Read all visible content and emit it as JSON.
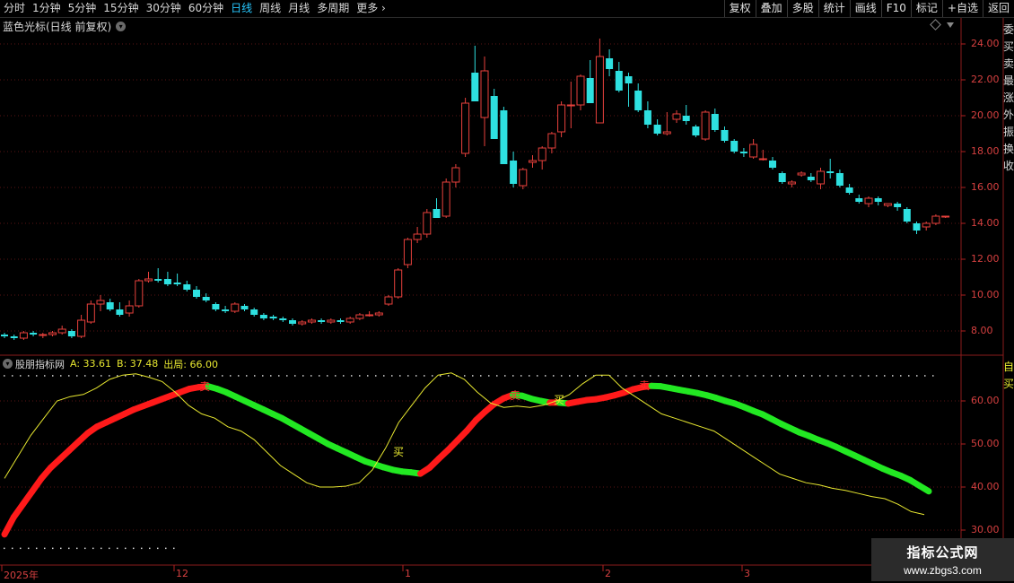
{
  "toolbar": {
    "periods": [
      "分时",
      "1分钟",
      "5分钟",
      "15分钟",
      "30分钟",
      "60分钟",
      "日线",
      "周线",
      "月线",
      "多周期",
      "更多"
    ],
    "active_period": "日线",
    "buttons": [
      "复权",
      "叠加",
      "多股",
      "统计",
      "画线",
      "F10",
      "标记",
      "+自选",
      "返回"
    ]
  },
  "price_chart": {
    "title": "蓝色光标(日线 前复权)",
    "axis_labels": [
      "24.00",
      "22.00",
      "20.00",
      "18.00",
      "16.00",
      "14.00",
      "12.00",
      "10.00",
      "8.00"
    ],
    "up_color": "#e8413c",
    "down_color": "#2ee0e0"
  },
  "indicator": {
    "name": "股朋指标网",
    "a_label": "A: 33.61",
    "b_label": "B: 37.48",
    "out_label": "出局: 66.00",
    "axis_labels": [
      "60.00",
      "50.00",
      "40.00",
      "30.00"
    ],
    "signals": {
      "sell": "卖",
      "buy": "买"
    },
    "colors": {
      "rising": "#ff1a1a",
      "falling": "#22e822",
      "line_a": "#e8e830",
      "dots": "#d8d8d8"
    }
  },
  "date_axis": [
    "2025年",
    "12",
    "1",
    "2",
    "3"
  ],
  "sidebar_text": "委买卖最涨外振换收",
  "sidebar_text_lower": "自买",
  "watermark": {
    "title": "指标公式网",
    "url": "www.zbgs3.com"
  },
  "chart_data": {
    "type": "candlestick",
    "title": "蓝色光标(日线 前复权)",
    "ylim": [
      7,
      25
    ],
    "candles": [
      [
        7.8,
        7.9,
        7.6,
        7.7
      ],
      [
        7.7,
        7.8,
        7.5,
        7.6
      ],
      [
        7.6,
        8.0,
        7.5,
        7.9
      ],
      [
        7.9,
        8.0,
        7.7,
        7.8
      ],
      [
        7.8,
        7.9,
        7.6,
        7.8
      ],
      [
        7.8,
        8.0,
        7.7,
        7.9
      ],
      [
        7.9,
        8.3,
        7.8,
        8.1
      ],
      [
        8.0,
        8.1,
        7.6,
        7.7
      ],
      [
        7.7,
        8.9,
        7.6,
        8.6
      ],
      [
        8.5,
        9.7,
        8.4,
        9.5
      ],
      [
        9.5,
        10.0,
        9.1,
        9.7
      ],
      [
        9.6,
        9.8,
        9.1,
        9.2
      ],
      [
        9.2,
        9.6,
        8.8,
        8.9
      ],
      [
        9.0,
        9.7,
        8.8,
        9.4
      ],
      [
        9.4,
        10.9,
        9.3,
        10.8
      ],
      [
        10.8,
        11.3,
        10.7,
        10.9
      ],
      [
        10.9,
        11.5,
        10.7,
        10.8
      ],
      [
        10.9,
        11.3,
        10.5,
        10.6
      ],
      [
        10.7,
        11.2,
        10.5,
        10.6
      ],
      [
        10.6,
        10.8,
        10.2,
        10.3
      ],
      [
        10.3,
        10.5,
        9.8,
        9.9
      ],
      [
        9.9,
        10.1,
        9.6,
        9.7
      ],
      [
        9.5,
        9.6,
        9.1,
        9.2
      ],
      [
        9.2,
        9.4,
        9.0,
        9.1
      ],
      [
        9.1,
        9.6,
        9.0,
        9.5
      ],
      [
        9.4,
        9.5,
        9.1,
        9.2
      ],
      [
        9.2,
        9.3,
        8.8,
        8.9
      ],
      [
        8.9,
        9.0,
        8.6,
        8.7
      ],
      [
        8.8,
        8.9,
        8.6,
        8.7
      ],
      [
        8.7,
        8.8,
        8.5,
        8.6
      ],
      [
        8.6,
        8.7,
        8.3,
        8.4
      ],
      [
        8.4,
        8.6,
        8.3,
        8.5
      ],
      [
        8.5,
        8.7,
        8.4,
        8.6
      ],
      [
        8.6,
        8.7,
        8.4,
        8.5
      ],
      [
        8.5,
        8.7,
        8.4,
        8.6
      ],
      [
        8.6,
        8.7,
        8.4,
        8.5
      ],
      [
        8.5,
        8.8,
        8.4,
        8.7
      ],
      [
        8.7,
        9.0,
        8.6,
        8.9
      ],
      [
        8.9,
        9.1,
        8.8,
        8.9
      ],
      [
        8.9,
        9.1,
        8.8,
        9.0
      ],
      [
        9.5,
        10.0,
        9.4,
        9.9
      ],
      [
        9.9,
        11.5,
        9.8,
        11.4
      ],
      [
        11.7,
        13.2,
        11.5,
        13.1
      ],
      [
        13.1,
        13.8,
        12.9,
        13.4
      ],
      [
        13.4,
        14.8,
        13.2,
        14.6
      ],
      [
        14.8,
        15.4,
        14.3,
        14.3
      ],
      [
        14.4,
        16.5,
        14.3,
        16.3
      ],
      [
        16.3,
        17.3,
        16.0,
        17.1
      ],
      [
        17.9,
        21.0,
        17.7,
        20.7
      ],
      [
        22.4,
        23.9,
        20.8,
        20.8
      ],
      [
        19.9,
        23.3,
        18.3,
        22.5
      ],
      [
        21.1,
        21.5,
        19.0,
        18.7
      ],
      [
        20.3,
        20.5,
        18.2,
        17.3
      ],
      [
        17.5,
        18.0,
        16.0,
        16.2
      ],
      [
        16.1,
        17.1,
        15.9,
        17.0
      ],
      [
        17.4,
        17.8,
        17.1,
        17.5
      ],
      [
        17.5,
        18.3,
        17.0,
        18.2
      ],
      [
        18.2,
        19.1,
        17.9,
        19.0
      ],
      [
        19.1,
        20.8,
        18.8,
        20.6
      ],
      [
        20.6,
        21.9,
        19.3,
        20.6
      ],
      [
        20.6,
        22.3,
        20.3,
        22.2
      ],
      [
        22.1,
        23.1,
        20.8,
        20.7
      ],
      [
        19.6,
        24.3,
        19.6,
        23.3
      ],
      [
        23.2,
        23.7,
        22.2,
        22.6
      ],
      [
        22.5,
        23.0,
        21.3,
        21.4
      ],
      [
        22.2,
        22.4,
        20.5,
        21.8
      ],
      [
        21.4,
        21.8,
        20.2,
        20.3
      ],
      [
        20.3,
        20.8,
        19.3,
        19.5
      ],
      [
        19.5,
        19.8,
        18.9,
        19.0
      ],
      [
        19.0,
        20.2,
        18.9,
        19.1
      ],
      [
        19.8,
        20.3,
        19.6,
        20.1
      ],
      [
        20.0,
        20.6,
        19.5,
        19.7
      ],
      [
        19.4,
        19.5,
        18.8,
        18.9
      ],
      [
        18.7,
        20.3,
        18.6,
        20.2
      ],
      [
        20.1,
        20.4,
        19.1,
        19.2
      ],
      [
        19.2,
        19.4,
        18.5,
        18.6
      ],
      [
        18.6,
        18.7,
        17.9,
        18.0
      ],
      [
        18.0,
        18.2,
        17.7,
        17.9
      ],
      [
        17.7,
        18.7,
        17.6,
        18.4
      ],
      [
        17.6,
        18.1,
        17.5,
        17.6
      ],
      [
        17.5,
        17.7,
        17.0,
        17.1
      ],
      [
        16.8,
        16.9,
        16.2,
        16.3
      ],
      [
        16.2,
        16.4,
        16.0,
        16.3
      ],
      [
        16.7,
        16.9,
        16.6,
        16.8
      ],
      [
        16.6,
        16.8,
        16.3,
        16.4
      ],
      [
        16.2,
        17.1,
        15.9,
        16.9
      ],
      [
        16.9,
        17.6,
        16.5,
        16.8
      ],
      [
        16.8,
        17.0,
        16.0,
        16.1
      ],
      [
        16.0,
        16.2,
        15.6,
        15.7
      ],
      [
        15.4,
        15.6,
        15.1,
        15.2
      ],
      [
        15.1,
        15.5,
        14.9,
        15.4
      ],
      [
        15.4,
        15.5,
        15.0,
        15.2
      ],
      [
        15.0,
        15.1,
        14.9,
        15.1
      ],
      [
        15.1,
        15.2,
        14.7,
        14.9
      ],
      [
        14.8,
        14.9,
        14.0,
        14.1
      ],
      [
        14.0,
        14.1,
        13.4,
        13.6
      ],
      [
        13.8,
        14.1,
        13.6,
        14.0
      ],
      [
        14.0,
        14.5,
        13.9,
        14.4
      ],
      [
        14.4,
        14.4,
        14.3,
        14.4
      ]
    ],
    "indicator": {
      "ylim": [
        28,
        68
      ],
      "out_level": 66,
      "main": [
        29,
        33,
        36,
        39,
        42,
        44.5,
        46.5,
        48.5,
        50.5,
        52.5,
        54,
        55,
        56,
        57,
        58,
        58.8,
        59.6,
        60.4,
        61.2,
        62,
        62.8,
        63.2,
        63.4,
        62.8,
        62,
        61,
        60,
        59,
        58,
        57,
        56,
        54.8,
        53.6,
        52.4,
        51.2,
        50,
        49,
        48,
        47,
        46,
        45.3,
        44.6,
        44,
        43.6,
        43.4,
        43.1,
        44.5,
        46.6,
        48.6,
        50.8,
        53,
        55.5,
        57.5,
        59.3,
        60.6,
        61.4,
        61.2,
        60.5,
        60,
        59.6,
        59.6,
        59.4,
        59.8,
        60.2,
        60.4,
        60.8,
        61.3,
        61.9,
        62.7,
        63.2,
        63.5,
        63.4,
        63,
        62.6,
        62.2,
        61.8,
        61.3,
        60.7,
        60,
        59.4,
        58.6,
        57.7,
        56.9,
        55.8,
        54.7,
        53.7,
        52.7,
        51.9,
        51,
        50.2,
        49.3,
        48.3,
        47.3,
        46.3,
        45.3,
        44.3,
        43.4,
        42.6,
        41.6,
        40.3,
        39
      ],
      "line_a": [
        42,
        47,
        52,
        56,
        60,
        61,
        61.5,
        63,
        65,
        66,
        66.3,
        65.5,
        64.5,
        62,
        59,
        57,
        56,
        54,
        53,
        51,
        48,
        45,
        43,
        41,
        40,
        40,
        40.2,
        41,
        44,
        49,
        55,
        59,
        63,
        66,
        66.5,
        65,
        62,
        59.5,
        58.5,
        58.8,
        58.5,
        59,
        60,
        61.5,
        64,
        66,
        66,
        63,
        61,
        59,
        57,
        56,
        55,
        54,
        53,
        51,
        49,
        47,
        45,
        43,
        42,
        41,
        40.5,
        39.7,
        39.2,
        38.5,
        37.8,
        37.3,
        36,
        34.3,
        33.6
      ]
    }
  }
}
